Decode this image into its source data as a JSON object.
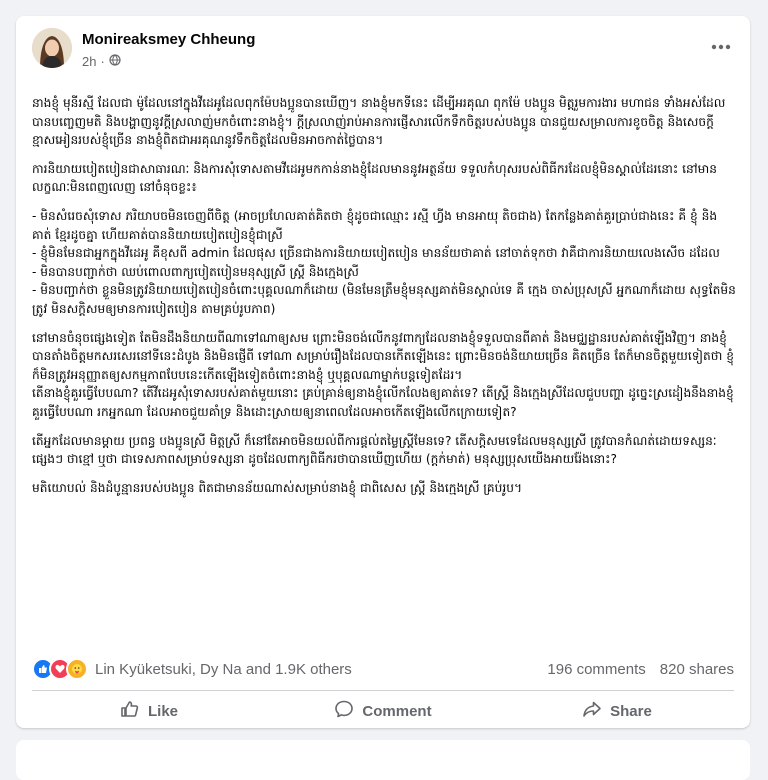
{
  "post": {
    "author": "Monireaksmey Chheung",
    "time": "2h",
    "dot": "·",
    "paragraphs_1": [
      "នាងខ្ញុំ មុនីរស្មី ដែលជា ម៉ូដែលនៅក្នុងវីដេអូដែលពុកម៉ែបងប្អូនបានឃើញ។ នាងខ្ញុំមកទីនេះ ដើម្បីអរគុណ ពុកម៉ែ បងប្អូន មិត្តរួមការងារ មហាជន ទាំងអស់ដែលបានបញ្ចេញមតិ និងបង្ហាញនូវក្តីស្រលាញ់មកចំពោះនាងខ្ញុំ។ ក្តីស្រលាញ់រាប់អានការផ្ញើសារលើកទឹកចិត្តរបស់បងប្អូន បានជួយសម្រាលការខូចចិត្ត និងសេចក្តីខ្មាសអៀនរបស់ខ្ញុំច្រើន នាងខ្ញុំពិតជាអរគុណនូវទឹកចិត្តដែលមិនអាចកាត់ថ្លៃបាន។",
      "ការនិយាយបៀតបៀនជាសាធារណៈ និងការសុំទោសតាមវីដេអូមកកាន់នាងខ្ញុំដែលមាននូវអត្ថន័យ ទទួលកំហុសរបស់ពិធីករដែលខ្ញុំមិនស្គាល់ដែរនោះ នៅមានលក្ខណៈមិនពេញលេញ នៅចំនុចខ្លះ៖"
    ],
    "bullets": [
      "- មិនសំរេចសុំទោស ភរិយាបចមិនចេញពីចិត្ត (អាចប្រហែលគាត់គិតថា ខ្ញុំដូចជាឈ្មោះ រស្មី ហ្វីង មានអាយុ តិចជាង) តែកន្លែងគាត់គួរប្រាប់ជាងនេះ គឺ ខ្ញុំ និងគាត់ ខ្មែរដូចគ្នា ហើយគាត់បាននិយាយបៀតបៀនខ្ញុំជាស្រី",
      "- ខ្ញុំមិនមែនជាអ្នកក្នុងវីដេអូ គឺខុសពី admin ដែលផុស ច្រើនជាងការនិយាយបៀតបៀន មានន័យថាគាត់ នៅចាត់ទុកថា វាគឺជាការនិយាយលេងសើច ដដែល",
      "- មិនបានបញ្ជាក់ថា ឈប់ពោលពាក្យបៀតបៀនមនុស្សស្រី ស្ត្រី និងក្មេងស្រី",
      "- មិនបញ្ជាក់ថា ខ្លួនមិនត្រូវនិយាយបៀតបៀនចំពោះបុគ្គលណាក៏ដោយ (មិនមែនត្រឹមខ្ញុំមនុស្សគាត់មិនស្គាល់ទេ គឺ ក្មេង ចាស់ប្រុសស្រី អ្នកណាក៏ដោយ សុទ្ធតែមិនត្រូវ មិនសក្តិសមឲ្យមានការបៀតបៀន តាមគ្រប់រូបភាព)"
    ],
    "paragraphs_2": [
      "នៅមានចំនុចផ្សេងទៀត តែមិនដឹងនិយាយពីណាទៅណាឲ្យសម ព្រោះមិនចង់លើកនូវពាក្យដែលនាងខ្ញុំទទួលបានពីគាត់ និងមជ្ឈដ្ឋានរបស់គាត់ឡើងវិញ។ នាងខ្ញុំបានតាំងចិត្តមកសរសេរនៅទីនេះដំបូង និងមិនផ្ញើពី ទៅណា សម្រាប់រឿងដែលបានកើតឡើងនេះ ព្រោះមិនចង់និយាយច្រើន គិតច្រើន តែក៏មានចិត្តមួយទៀតថា ខ្ញុំក៏មិនត្រូវអនុញ្ញាតឲ្យសកម្មភាពបែបនេះកើតឡើងទៀតចំពោះនាងខ្ញុំ ឬបុគ្គលណាម្នាក់បន្តទៀតដែរ។\nតើនាងខ្ញុំគួរធ្វើបែបណា? តើវីដេអូសុំទោសរបស់គាត់មួយនោះ គ្រប់គ្រាន់ឲ្យនាងខ្ញុំលើកលែងឲ្យគាត់ទេ? តើស្ត្រី និងក្មេងស្រីដែលជួបបញ្ហា ដូច្នេះស្រដៀងនឹងនាងខ្ញុំ គួរធ្វើបែបណា រកអ្នកណា ដែលអាចជួយគាំទ្រ និងដោះស្រាយឲ្យនាពេលដែលអាចកើតឡើងលើកក្រោយទៀត?",
      "តើអ្នកដែលមានម្តាយ ប្រពន្ធ បងប្អូនស្រី មិត្តស្រី ក៏នៅតែអាចមិនយល់ពីការផ្តល់តម្លៃស្ត្រីមែនទេ? តើសក្តិសមទេដែលមនុស្សស្រី ត្រូវបានកំណត់ដោយទស្សនៈផ្សេងៗ ថាខ្មៅ ឬថា ជាទេសភាពសម្រាប់ទស្សនា ដូចដែលពាក្យពិធីករថាបានឃើញហើយ (ក្តក់មាត់) មនុស្សប្រុសយើងអាយរ៉ែងនោះ?",
      "មតិយោបល់ និងដំបូន្មានរបស់បងប្អូន ពិតជាមានន័យណាស់សម្រាប់នាងខ្ញុំ ជាពិសេស ស្ត្រី និងក្មេងស្រី គ្រប់រូប។"
    ]
  },
  "stats": {
    "reactors": "Lin Kyüketsuki, Dy Na and 1.9K others",
    "comments": "196 comments",
    "shares": "820 shares"
  },
  "actions": {
    "like": "Like",
    "comment": "Comment",
    "share": "Share"
  },
  "colors": {
    "accent": "#1877f2",
    "love": "#f33e58",
    "care": "#f7b125",
    "secondary_text": "#65676b"
  },
  "icons": [
    "globe-icon",
    "more-icon",
    "like-reaction-icon",
    "love-reaction-icon",
    "care-reaction-icon",
    "like-icon",
    "comment-icon",
    "share-icon"
  ]
}
